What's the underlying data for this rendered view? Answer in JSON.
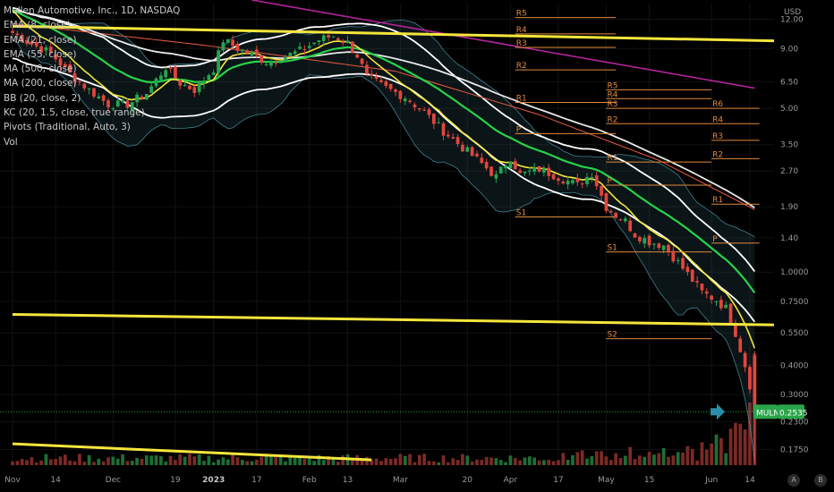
{
  "symbol_title": "Mullen Automotive, Inc., 1D, NASDAQ",
  "indicators": [
    "EMA (8, close)",
    "EMA (21, close)",
    "EMA (55, close)",
    "MA (500, close)",
    "MA (200, close)",
    "BB (20, close, 2)",
    "KC (20, 1.5, close, true range)",
    "Pivots (Traditional, Auto, 3)",
    "Vol"
  ],
  "currency": "USD",
  "ticker_badge": "MULN",
  "price_badge": "0.2535",
  "corner_buttons": [
    "A",
    "B"
  ],
  "colors": {
    "background": "#000000",
    "up": "#26a650",
    "down": "#e0463c",
    "ema8": "#f5e63c",
    "ema21": "#26d34a",
    "ema55": "#e8e8e8",
    "ma500": "#b4249c",
    "ma200": "#d8543c",
    "bb": "#5ab4c8",
    "kc": "#ffffff",
    "pivot": "#e08a3c",
    "trendline": "#f5e63c",
    "badge": "#2aa54a"
  },
  "chart_data": {
    "type": "candlestick",
    "title": "Mullen Automotive, Inc., 1D, NASDAQ",
    "y_scale": "log",
    "ylim": [
      0.15,
      14
    ],
    "y_ticks": [
      12.0,
      9.0,
      6.5,
      5.0,
      3.5,
      2.7,
      1.9,
      1.4,
      1.0,
      0.75,
      0.55,
      0.4,
      0.3,
      0.23,
      0.175
    ],
    "y_tick_labels": [
      "12.00",
      "9.00",
      "6.50",
      "5.00",
      "3.50",
      "2.70",
      "1.90",
      "1.40",
      "1.0000",
      "0.7500",
      "0.5500",
      "0.4000",
      "0.3000",
      "0.2300",
      "0.1750"
    ],
    "x_ticks": [
      {
        "label": "Nov",
        "i": 0
      },
      {
        "label": "14",
        "i": 9
      },
      {
        "label": "Dec",
        "i": 21
      },
      {
        "label": "19",
        "i": 34
      },
      {
        "label": "2023",
        "i": 42
      },
      {
        "label": "17",
        "i": 51
      },
      {
        "label": "Feb",
        "i": 62
      },
      {
        "label": "13",
        "i": 70
      },
      {
        "label": "Mar",
        "i": 81
      },
      {
        "label": "20",
        "i": 95
      },
      {
        "label": "Apr",
        "i": 104
      },
      {
        "label": "17",
        "i": 114
      },
      {
        "label": "May",
        "i": 124
      },
      {
        "label": "15",
        "i": 133
      },
      {
        "label": "Jun",
        "i": 146
      },
      {
        "label": "14",
        "i": 154
      }
    ],
    "bars": 156,
    "close_anchors": [
      {
        "i": 0,
        "v": 10.5
      },
      {
        "i": 4,
        "v": 9.4
      },
      {
        "i": 8,
        "v": 8.6
      },
      {
        "i": 12,
        "v": 7.0
      },
      {
        "i": 16,
        "v": 6.0
      },
      {
        "i": 20,
        "v": 5.2
      },
      {
        "i": 24,
        "v": 5.2
      },
      {
        "i": 28,
        "v": 5.8
      },
      {
        "i": 32,
        "v": 7.5
      },
      {
        "i": 35,
        "v": 6.4
      },
      {
        "i": 38,
        "v": 6.0
      },
      {
        "i": 42,
        "v": 7.4
      },
      {
        "i": 44,
        "v": 9.8
      },
      {
        "i": 47,
        "v": 9.0
      },
      {
        "i": 50,
        "v": 8.5
      },
      {
        "i": 53,
        "v": 7.9
      },
      {
        "i": 56,
        "v": 8.2
      },
      {
        "i": 60,
        "v": 8.8
      },
      {
        "i": 64,
        "v": 9.8
      },
      {
        "i": 67,
        "v": 10.2
      },
      {
        "i": 70,
        "v": 9.5
      },
      {
        "i": 72,
        "v": 8.4
      },
      {
        "i": 74,
        "v": 6.8
      },
      {
        "i": 78,
        "v": 6.1
      },
      {
        "i": 82,
        "v": 5.6
      },
      {
        "i": 86,
        "v": 4.8
      },
      {
        "i": 90,
        "v": 4.0
      },
      {
        "i": 94,
        "v": 3.4
      },
      {
        "i": 98,
        "v": 2.9
      },
      {
        "i": 101,
        "v": 2.55
      },
      {
        "i": 104,
        "v": 3.1
      },
      {
        "i": 106,
        "v": 2.6
      },
      {
        "i": 110,
        "v": 2.75
      },
      {
        "i": 114,
        "v": 2.55
      },
      {
        "i": 118,
        "v": 2.35
      },
      {
        "i": 121,
        "v": 2.65
      },
      {
        "i": 124,
        "v": 1.9
      },
      {
        "i": 126,
        "v": 1.75
      },
      {
        "i": 128,
        "v": 1.65
      },
      {
        "i": 130,
        "v": 1.45
      },
      {
        "i": 133,
        "v": 1.35
      },
      {
        "i": 136,
        "v": 1.3
      },
      {
        "i": 139,
        "v": 1.1
      },
      {
        "i": 141,
        "v": 0.98
      },
      {
        "i": 144,
        "v": 0.82
      },
      {
        "i": 147,
        "v": 0.76
      },
      {
        "i": 149,
        "v": 0.7
      },
      {
        "i": 151,
        "v": 0.55
      },
      {
        "i": 153,
        "v": 0.4
      },
      {
        "i": 154,
        "v": 0.33
      },
      {
        "i": 155,
        "v": 0.2535
      }
    ],
    "ma500": [
      {
        "i": 50,
        "v": 14.5
      },
      {
        "i": 155,
        "v": 6.1
      }
    ],
    "ma200": [
      {
        "i": 0,
        "v": 11.5
      },
      {
        "i": 40,
        "v": 9.3
      },
      {
        "i": 80,
        "v": 7.2
      },
      {
        "i": 110,
        "v": 4.7
      },
      {
        "i": 135,
        "v": 3.0
      },
      {
        "i": 155,
        "v": 1.85
      }
    ],
    "pivots": [
      {
        "from": 105,
        "to": 126,
        "levels": [
          {
            "label": "R5",
            "v": 12.2
          },
          {
            "label": "R4",
            "v": 10.4
          },
          {
            "label": "R3",
            "v": 9.1
          },
          {
            "label": "R2",
            "v": 7.3
          },
          {
            "label": "R1",
            "v": 5.3
          },
          {
            "label": "P",
            "v": 3.9
          },
          {
            "label": "S1",
            "v": 1.72
          }
        ]
      },
      {
        "from": 124,
        "to": 146,
        "levels": [
          {
            "label": "R5",
            "v": 6.0
          },
          {
            "label": "R4",
            "v": 5.5
          },
          {
            "label": "R3",
            "v": 5.0
          },
          {
            "label": "R2",
            "v": 4.3
          },
          {
            "label": "R1",
            "v": 2.95
          },
          {
            "label": "P",
            "v": 2.35
          },
          {
            "label": "S1",
            "v": 1.22
          },
          {
            "label": "S2",
            "v": 0.52
          }
        ]
      },
      {
        "from": 146,
        "to": 156,
        "levels": [
          {
            "label": "R6",
            "v": 5.0
          },
          {
            "label": "R4",
            "v": 4.3
          },
          {
            "label": "R3",
            "v": 3.65
          },
          {
            "label": "R2",
            "v": 3.05
          },
          {
            "label": "R1",
            "v": 1.95
          },
          {
            "label": "P",
            "v": 1.33
          }
        ]
      }
    ],
    "trendlines": [
      {
        "from": {
          "i": 0,
          "v": 11.2
        },
        "to": {
          "i": 160,
          "v": 9.7
        }
      },
      {
        "from": {
          "i": 0,
          "v": 0.66
        },
        "to": {
          "i": 160,
          "v": 0.595
        }
      },
      {
        "from": {
          "i": 0,
          "v": 0.185
        },
        "to": {
          "i": 75,
          "v": 0.158
        }
      }
    ],
    "last_price": 0.2535
  }
}
